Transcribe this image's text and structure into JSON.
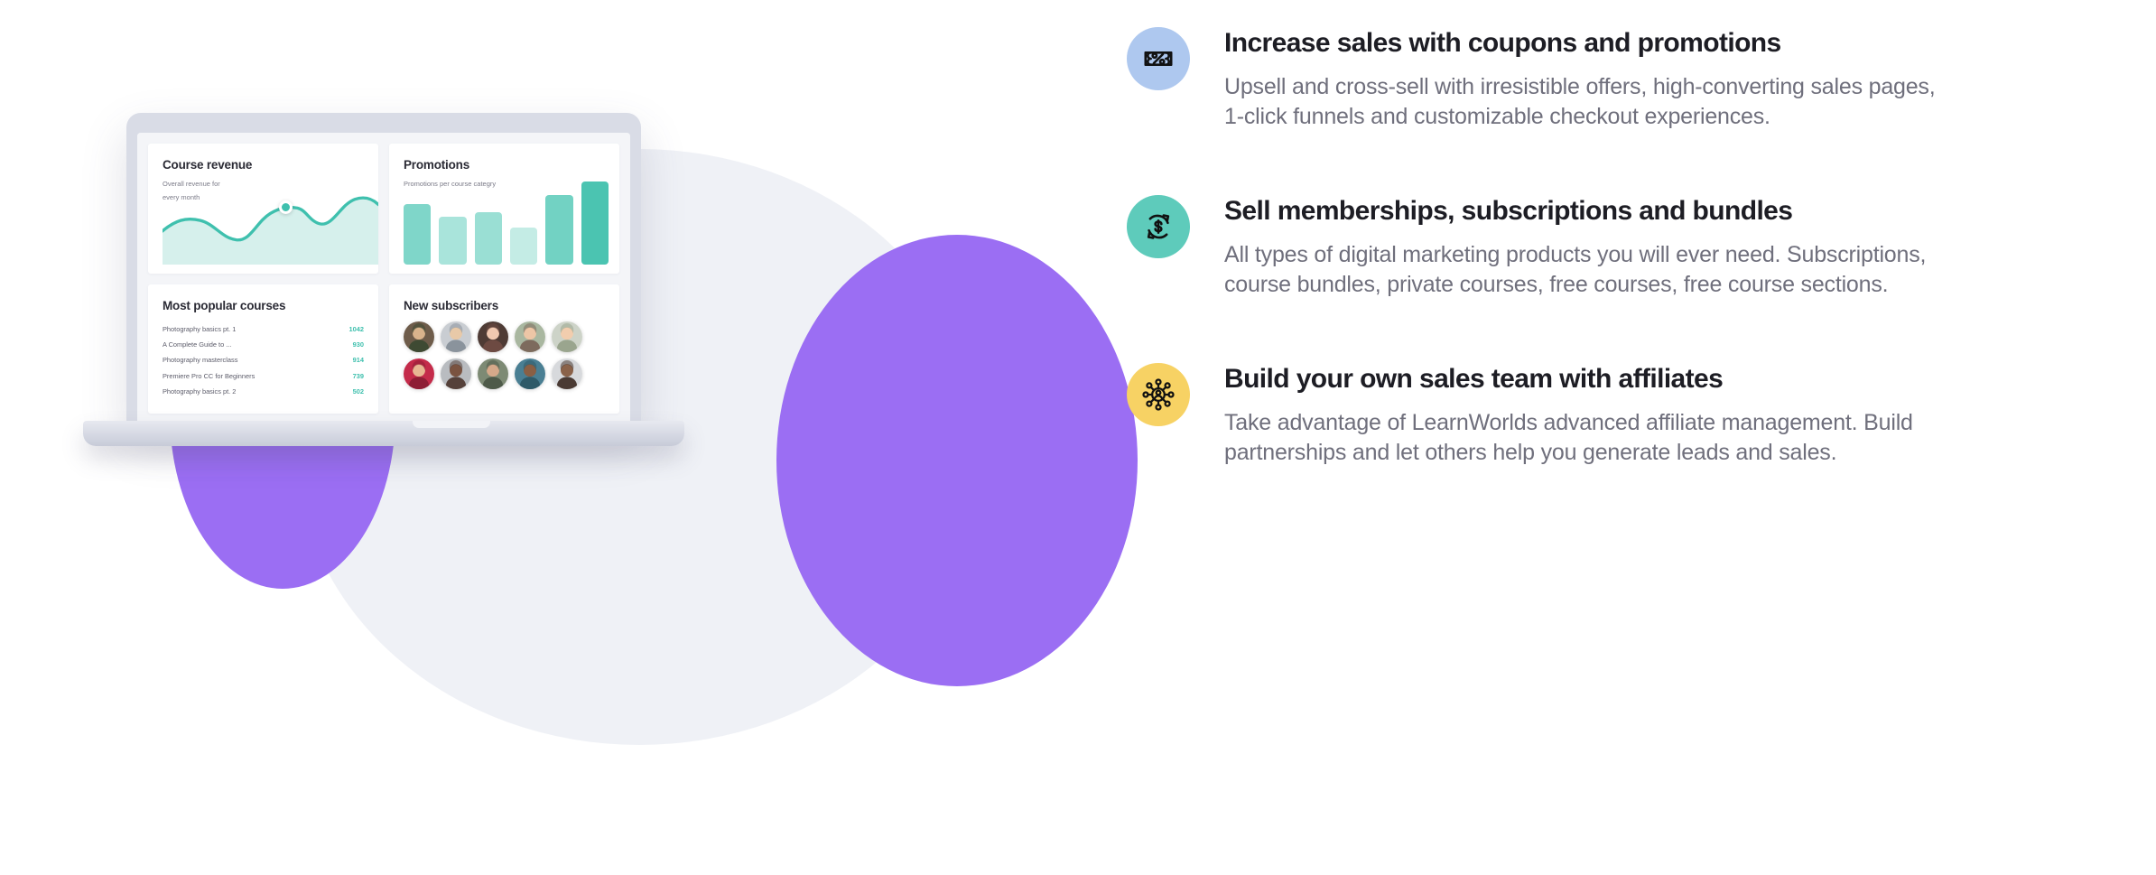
{
  "illustration": {
    "device": "laptop-mockup",
    "colors": {
      "purple_blob": "#9b6ef3",
      "gray_blob": "#eceef4",
      "laptop_body": "#d9dce6",
      "accent_teal": "#3fc0ae"
    },
    "dashboard": {
      "cards": [
        {
          "id": "course-revenue",
          "title": "Course revenue",
          "subtitle_line1": "Overall revenue for",
          "subtitle_line2": "every month"
        },
        {
          "id": "promotions",
          "title": "Promotions",
          "subtitle": "Promotions per course categry"
        },
        {
          "id": "most-popular-courses",
          "title": "Most popular courses"
        },
        {
          "id": "new-subscribers",
          "title": "New subscribers"
        }
      ],
      "courses": [
        {
          "name": "Photography basics pt. 1",
          "value": "1042"
        },
        {
          "name": "A Complete Guide to ...",
          "value": "930"
        },
        {
          "name": "Photography masterclass",
          "value": "914"
        },
        {
          "name": "Premiere Pro CC for Beginners",
          "value": "739"
        },
        {
          "name": "Photography basics pt. 2",
          "value": "502"
        }
      ],
      "subscriber_count": 10
    }
  },
  "chart_data": [
    {
      "type": "area",
      "id": "course-revenue-chart",
      "title": "Course revenue",
      "subtitle": "Overall revenue for every month",
      "xlabel": "",
      "ylabel": "",
      "grid": false,
      "legend": false,
      "line_color": "#3fc0ae",
      "fill_color": "#d6f0ec",
      "marker": {
        "x_index": 6,
        "value": 62,
        "color": "#3fc0ae"
      },
      "x": [
        0,
        1,
        2,
        3,
        4,
        5,
        6,
        7,
        8,
        9,
        10
      ],
      "values": [
        38,
        44,
        40,
        30,
        28,
        44,
        62,
        64,
        50,
        78,
        72
      ]
    },
    {
      "type": "bar",
      "id": "promotions-chart",
      "title": "Promotions",
      "subtitle": "Promotions per course categry",
      "xlabel": "",
      "ylabel": "",
      "grid": false,
      "legend": false,
      "categories": [
        "1",
        "2",
        "3",
        "4",
        "5",
        "6"
      ],
      "values": [
        72,
        57,
        62,
        44,
        83,
        100
      ],
      "ylim": [
        0,
        100
      ],
      "bar_colors": [
        "#7fd6c9",
        "#a9e4db",
        "#9adfd4",
        "#c4ece5",
        "#72d2c3",
        "#4bc4b1"
      ]
    }
  ],
  "features": [
    {
      "icon": "coupon-percent-icon",
      "icon_bg": "#aec8ef",
      "title": "Increase sales with coupons and promotions",
      "description": "Upsell and cross-sell with irresistible offers, high-converting sales pages, 1-click funnels and customizable checkout experiences."
    },
    {
      "icon": "subscription-recurring-dollar-icon",
      "icon_bg": "#5ecbbb",
      "title": "Sell memberships, subscriptions and bundles",
      "description": "All types of digital marketing products you will ever need. Subscriptions, course bundles, private courses, free courses, free course sections."
    },
    {
      "icon": "affiliate-network-icon",
      "icon_bg": "#f7d264",
      "title": "Build your own sales team with affiliates",
      "description": "Take advantage of LearnWorlds advanced affiliate management. Build partnerships and let others help you generate leads and sales."
    }
  ]
}
